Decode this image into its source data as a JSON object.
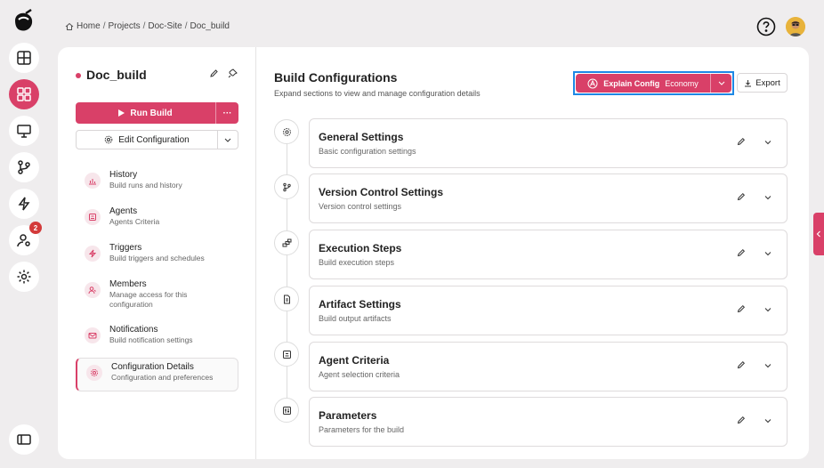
{
  "breadcrumb": {
    "home": "Home",
    "projects": "Projects",
    "site": "Doc-Site",
    "current": "Doc_build",
    "sep": "/"
  },
  "rail": {
    "notification_count": "2"
  },
  "project": {
    "name": "Doc_build"
  },
  "actions": {
    "run_build": "Run Build",
    "run_more": "···",
    "edit_config": "Edit Configuration"
  },
  "nav": [
    {
      "title": "History",
      "subtitle": "Build runs and history",
      "icon": "chart-icon"
    },
    {
      "title": "Agents",
      "subtitle": "Agents Criteria",
      "icon": "agent-icon"
    },
    {
      "title": "Triggers",
      "subtitle": "Build triggers and schedules",
      "icon": "lightning-icon"
    },
    {
      "title": "Members",
      "subtitle": "Manage access for this configuration",
      "icon": "members-icon"
    },
    {
      "title": "Notifications",
      "subtitle": "Build notification settings",
      "icon": "mail-icon"
    },
    {
      "title": "Configuration Details",
      "subtitle": "Configuration and preferences",
      "icon": "gear-icon"
    }
  ],
  "main": {
    "title": "Build Configurations",
    "subtitle": "Expand sections to view and manage configuration details",
    "explain_label": "Explain Config",
    "explain_mode": "Economy",
    "export_label": "Export"
  },
  "sections": [
    {
      "title": "General Settings",
      "subtitle": "Basic configuration settings"
    },
    {
      "title": "Version Control Settings",
      "subtitle": "Version control settings"
    },
    {
      "title": "Execution Steps",
      "subtitle": "Build execution steps"
    },
    {
      "title": "Artifact Settings",
      "subtitle": "Build output artifacts"
    },
    {
      "title": "Agent Criteria",
      "subtitle": "Agent selection criteria"
    },
    {
      "title": "Parameters",
      "subtitle": "Parameters for the build"
    }
  ],
  "colors": {
    "accent": "#d94068",
    "focus": "#1e88e5"
  }
}
